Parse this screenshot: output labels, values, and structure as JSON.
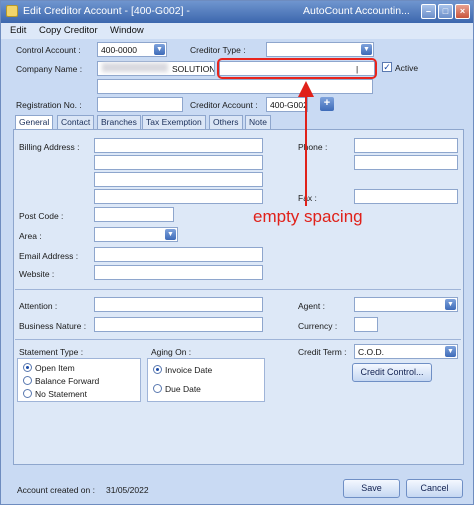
{
  "window": {
    "title": "Edit Creditor Account - [400-G002] -",
    "app_name": "AutoCount Accountin..."
  },
  "menu": [
    "Edit",
    "Copy Creditor",
    "Window"
  ],
  "header": {
    "control_account_label": "Control Account :",
    "control_account_value": "400-0000",
    "creditor_type_label": "Creditor Type :",
    "creditor_type_value": "",
    "company_name_label": "Company Name :",
    "company_name_value": "SOLUTIONS",
    "active_label": "Active",
    "active_checked": true,
    "registration_label": "Registration No. :",
    "registration_value": "",
    "creditor_account_label": "Creditor Account :",
    "creditor_account_value": "400-G002"
  },
  "tabs": [
    "General",
    "Contact",
    "Branches",
    "Tax Exemption",
    "Others",
    "Note"
  ],
  "general": {
    "billing_address_label": "Billing Address :",
    "phone_label": "Phone :",
    "fax_label": "Fax :",
    "post_code_label": "Post Code :",
    "area_label": "Area :",
    "email_label": "Email  Address :",
    "website_label": "Website :",
    "attention_label": "Attention :",
    "agent_label": "Agent :",
    "business_nature_label": "Business Nature :",
    "currency_label": "Currency :",
    "statement_type_label": "Statement Type :",
    "statement_options": [
      "Open Item",
      "Balance Forward",
      "No Statement"
    ],
    "aging_on_label": "Aging On :",
    "aging_options": [
      "Invoice Date",
      "Due Date"
    ],
    "credit_term_label": "Credit Term :",
    "credit_term_value": "C.O.D.",
    "credit_control_button": "Credit Control..."
  },
  "footer": {
    "account_created_label": "Account created on :",
    "account_created_value": "31/05/2022",
    "save_button": "Save",
    "cancel_button": "Cancel"
  },
  "annotation": {
    "text": "empty spacing",
    "color": "#e0211a"
  }
}
